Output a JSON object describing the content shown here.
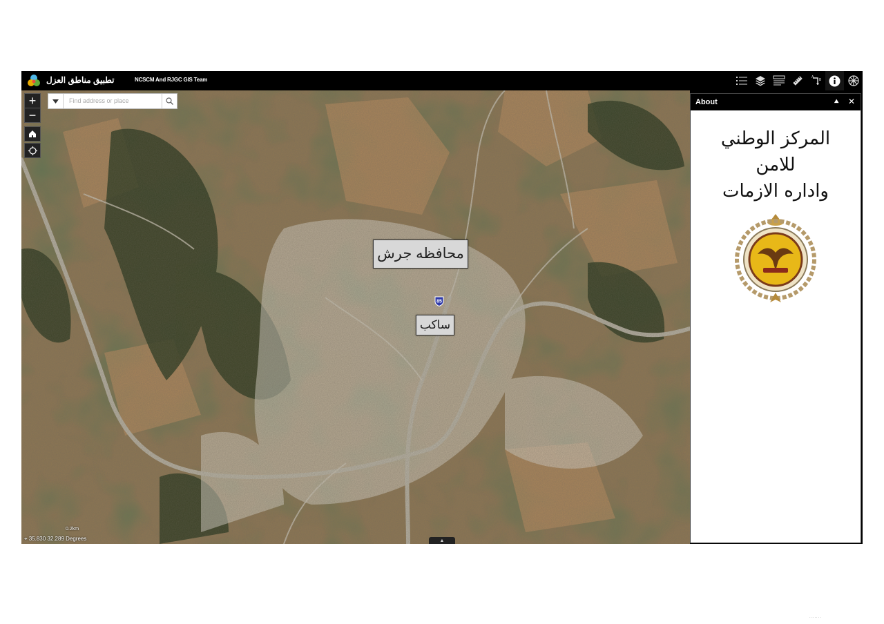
{
  "header": {
    "app_title": "تطبيق مناطق العزل",
    "subtitle": "NCSCM And RJGC GIS Team"
  },
  "toolbar": {
    "items": [
      {
        "icon": "legend-list-icon"
      },
      {
        "icon": "layers-icon"
      },
      {
        "icon": "attribute-table-icon"
      },
      {
        "icon": "measure-ruler-icon"
      },
      {
        "icon": "directions-icon"
      },
      {
        "icon": "about-info-icon"
      },
      {
        "icon": "basemap-gallery-icon"
      }
    ]
  },
  "map": {
    "search_placeholder": "Find address or place",
    "zoom_in": "+",
    "zoom_out": "−",
    "labels": {
      "governorate": "محافظه جرش",
      "town": "ساكب"
    },
    "route_shield": "85",
    "coordinates": "35.830 32.289 Degrees",
    "scale_text": "0.2km",
    "bottom_tab": "▲"
  },
  "about_panel": {
    "title": "About",
    "org_lines": [
      "المركز الوطني",
      "للامن",
      "واداره الازمات"
    ]
  },
  "footer_mark": "· ·· ·· · ·"
}
